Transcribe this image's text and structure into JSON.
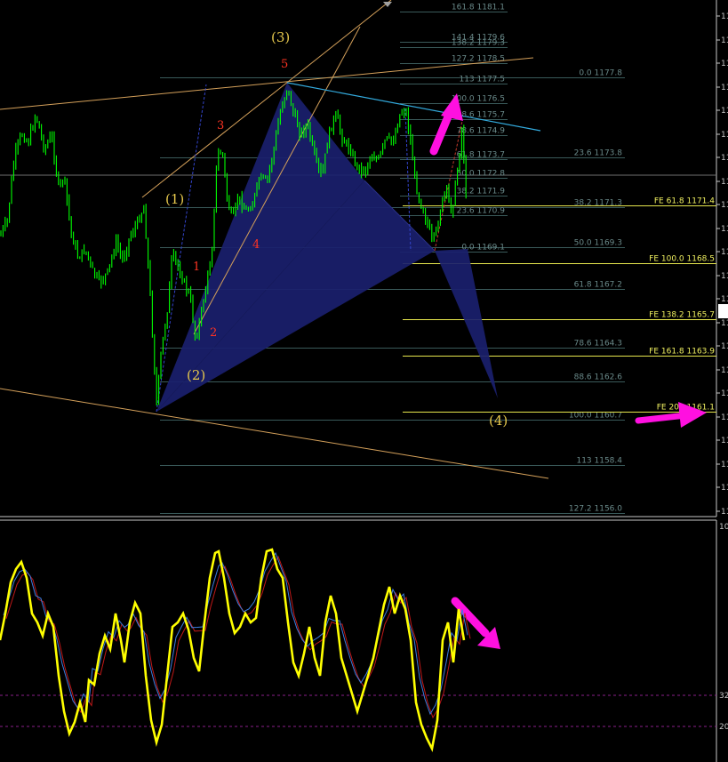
{
  "chart_data": {
    "type": "line",
    "price_pane": {
      "fib_retracement": [
        {
          "label": "161.8 1181.1",
          "price": 1181.1
        },
        {
          "label": "141.4 1179.6",
          "price": 1179.6
        },
        {
          "label": "138.2 1179.3",
          "price": 1179.3
        },
        {
          "label": "127.2 1178.5",
          "price": 1178.5
        },
        {
          "label": "113 1177.5",
          "price": 1177.5
        },
        {
          "label": "100.0 1176.5",
          "price": 1176.5
        },
        {
          "label": "88.6 1175.7",
          "price": 1175.7
        },
        {
          "label": "78.6 1174.9",
          "price": 1174.9
        },
        {
          "label": "61.8 1173.7",
          "price": 1173.7
        },
        {
          "label": "50.0 1172.8",
          "price": 1172.8
        },
        {
          "label": "38.2 1171.9",
          "price": 1171.9
        },
        {
          "label": "23.6 1170.9",
          "price": 1170.9
        },
        {
          "label": "0.0 1169.1",
          "price": 1169.1
        }
      ],
      "fib_main": [
        {
          "label": "0.0 1177.8",
          "price": 1177.8
        },
        {
          "label": "23.6 1173.8",
          "price": 1173.8
        },
        {
          "label": "38.2 1171.3",
          "price": 1171.3
        },
        {
          "label": "50.0 1169.3",
          "price": 1169.3
        },
        {
          "label": "61.8 1167.2",
          "price": 1167.2
        },
        {
          "label": "78.6 1164.3",
          "price": 1164.3
        },
        {
          "label": "88.6 1162.6",
          "price": 1162.6
        },
        {
          "label": "100.0 1160.7",
          "price": 1160.7
        },
        {
          "label": "113 1158.4",
          "price": 1158.4
        },
        {
          "label": "127.2 1156.0",
          "price": 1156.0
        }
      ],
      "fib_expansion": [
        {
          "label": "FE 61.8 1171.4",
          "price": 1171.4
        },
        {
          "label": "FE 100.0 1168.5",
          "price": 1168.5
        },
        {
          "label": "FE 138.2 1165.7",
          "price": 1165.7
        },
        {
          "label": "FE 161.8 1163.9",
          "price": 1163.9
        },
        {
          "label": "FE 200 1161.1",
          "price": 1161.1
        }
      ],
      "wave_labels": {
        "major": [
          "(1)",
          "(2)",
          "(3)",
          "(4)"
        ],
        "minor": [
          "1",
          "2",
          "3",
          "4",
          "5"
        ]
      },
      "axis_tick_label": "11"
    },
    "oscillator_pane": {
      "levels": [
        {
          "label": "32",
          "value": 32
        },
        {
          "label": "20",
          "value": 20
        }
      ],
      "top_label": "10"
    },
    "colors": {
      "candles": "#00ff00",
      "pattern_fill": "#1a1f6e",
      "retracement_lines": "#3a5a5a",
      "expansion_lines": "#e6e64d",
      "channel": "#d4a05a",
      "trendline": "#33aadd",
      "arrows": "#ff10e0",
      "osc_main": "#ffff00",
      "osc_signal_a": "#3c7de0",
      "osc_signal_b": "#c01818",
      "major_wave": "#e6c84d",
      "minor_wave": "#ff3322"
    }
  }
}
